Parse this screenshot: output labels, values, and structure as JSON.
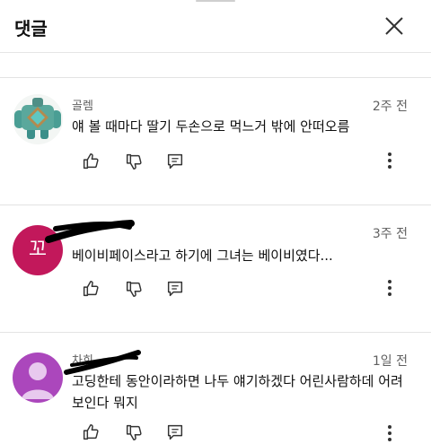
{
  "header": {
    "title": "댓글"
  },
  "comments": [
    {
      "author": "골렘",
      "time": "2주 전",
      "text": "얘 볼 때마다 딸기 두손으로 먹느거 밖에 안떠오름"
    },
    {
      "author": "",
      "avatar_letter": "꼬",
      "avatar_color": "#c2185b",
      "time": "3주 전",
      "text": "베이비페이스라고 하기에 그녀는 베이비였다..."
    },
    {
      "author": "차희",
      "avatar_color": "#ab47bc",
      "time": "1일 전",
      "text": "고딩한테  동안이라하면 나두 얘기하겠다  어린사람하데 어려보인다  뭐지"
    }
  ]
}
